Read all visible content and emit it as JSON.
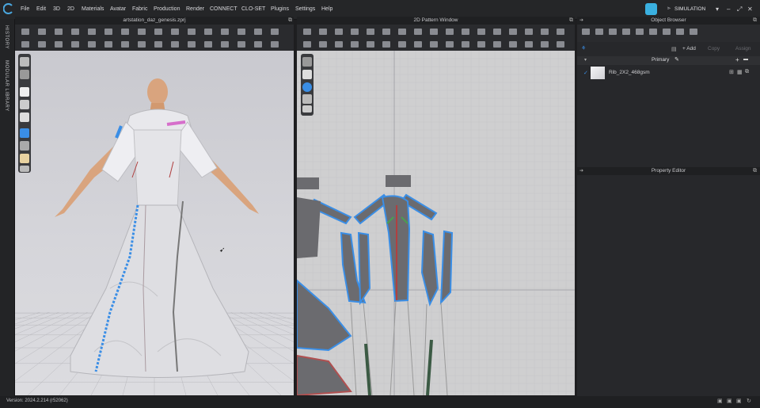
{
  "menu": [
    "File",
    "Edit",
    "3D",
    "2D",
    "Materials",
    "Avatar",
    "Fabric",
    "Production",
    "Render",
    "CONNECT",
    "CLO-SET",
    "Plugins",
    "Settings",
    "Help"
  ],
  "simulation_label": "SIMULATION",
  "left_tabs": {
    "history": "HISTORY",
    "modular_library": "MODULAR LIBRARY"
  },
  "view3d": {
    "title": "artstation_daz_genesis.zprj"
  },
  "view2d": {
    "title": "2D Pattern Window"
  },
  "object_browser": {
    "title": "Object Browser",
    "add_label": "+ Add",
    "copy_label": "Copy",
    "assign_label": "Assign",
    "group_label": "Primary",
    "fabric_name": "Rib_2X2_468gsm"
  },
  "property_editor": {
    "title": "Property Editor"
  },
  "status": {
    "version": "Version: 2024.2.214 (r52062)"
  },
  "colors": {
    "accent_blue": "#3a8ee6",
    "brand": "#3ab0e0"
  }
}
